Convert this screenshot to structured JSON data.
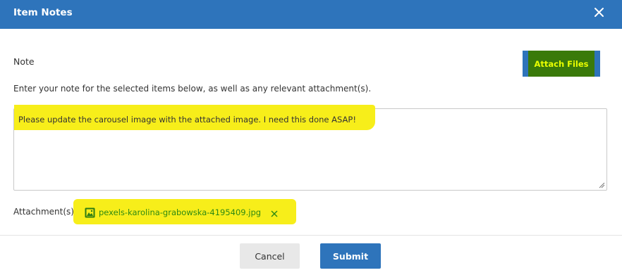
{
  "dialog": {
    "title": "Item Notes",
    "close_icon": "close-icon"
  },
  "note": {
    "label": "Note",
    "instructions": "Enter your note for the selected items below, as well as any relevant attachment(s).",
    "text": "Please update the carousel image with the attached image. I need this done ASAP!"
  },
  "attach_button": {
    "label": "Attach Files"
  },
  "attachments": {
    "label": "Attachment(s):",
    "files": [
      {
        "name": "pexels-karolina-grabowska-4195409.jpg",
        "icon": "image-file-icon",
        "remove_icon": "remove-icon"
      }
    ]
  },
  "footer": {
    "cancel_label": "Cancel",
    "submit_label": "Submit"
  },
  "colors": {
    "primary": "#2e74bb",
    "highlight": "#f7ee1a",
    "file_link": "#2e8a12"
  }
}
